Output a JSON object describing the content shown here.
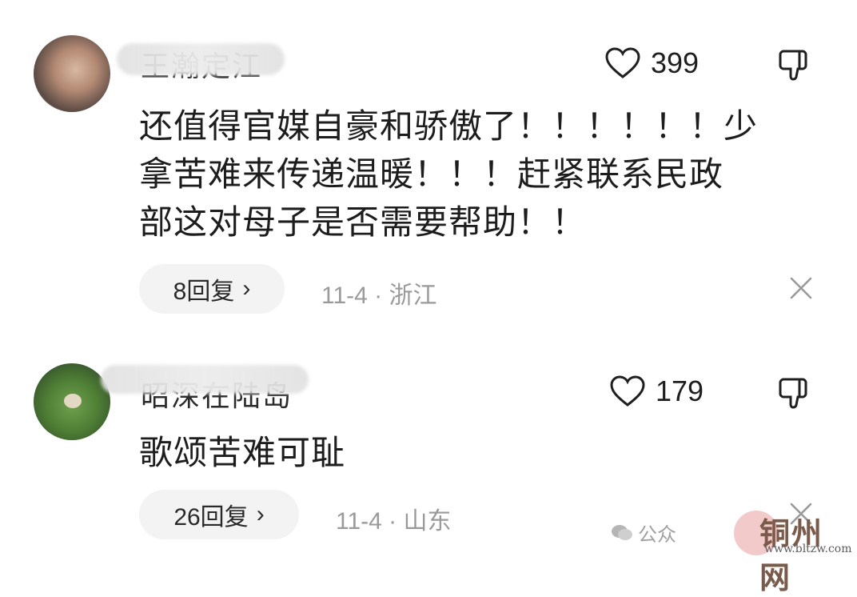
{
  "comments": [
    {
      "username": "王瀚定江",
      "likes": "399",
      "text_lines": [
        "还值得官媒自豪和骄傲了！！！！！！少",
        "拿苦难来传递温暖！！！赶紧联系民政",
        "部这对母子是否需要帮助！！"
      ],
      "reply_label": "8回复",
      "date": "11-4",
      "location": "浙江"
    },
    {
      "username": "昭深在陆岛",
      "likes": "179",
      "text_lines": [
        "歌颂苦难可耻"
      ],
      "reply_label": "26回复",
      "date": "11-4",
      "location": "山东"
    }
  ],
  "watermark": {
    "prefix": "公众",
    "title": "铜州网",
    "url": "www.bltzw.com"
  },
  "colors": {
    "reply_bg": "#f3f3f3",
    "meta": "#9a9a9a"
  },
  "icons": [
    "heart-icon",
    "thumbs-down-icon",
    "close-icon",
    "chevron-right-icon",
    "wechat-icon"
  ]
}
